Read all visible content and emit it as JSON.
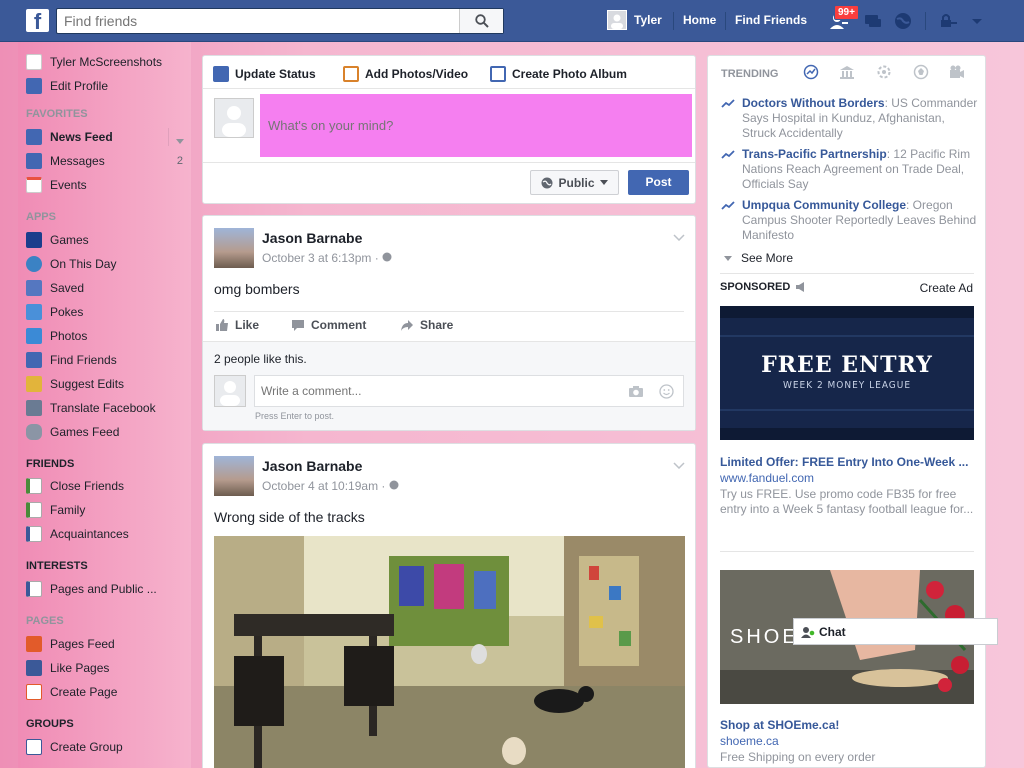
{
  "topbar": {
    "logo": "f",
    "search_placeholder": "Find friends",
    "user_name": "Tyler",
    "home_label": "Home",
    "find_friends_label": "Find Friends",
    "notif_badge": "99+"
  },
  "left_nav": {
    "profile": {
      "name": "Tyler McScreenshots",
      "edit": "Edit Profile"
    },
    "favorites_header": "FAVORITES",
    "favorites": [
      {
        "label": "News Feed",
        "icon": "news-feed-icon",
        "color": "#4267b2"
      },
      {
        "label": "Messages",
        "icon": "messages-icon",
        "color": "#4267b2",
        "count": "2"
      },
      {
        "label": "Events",
        "icon": "events-icon",
        "color": "#e9ebee"
      }
    ],
    "apps_header": "APPS",
    "apps": [
      {
        "label": "Games",
        "icon": "games-icon",
        "color": "#1a3e8c"
      },
      {
        "label": "On This Day",
        "icon": "on-this-day-icon",
        "color": "#3b82c4"
      },
      {
        "label": "Saved",
        "icon": "saved-icon",
        "color": "#5577c0"
      },
      {
        "label": "Pokes",
        "icon": "pokes-icon",
        "color": "#4a90d9"
      },
      {
        "label": "Photos",
        "icon": "photos-icon",
        "color": "#3b8ad6"
      },
      {
        "label": "Find Friends",
        "icon": "find-friends-icon",
        "color": "#4267b2"
      },
      {
        "label": "Suggest Edits",
        "icon": "suggest-edits-icon",
        "color": "#e2b43b"
      },
      {
        "label": "Translate Facebook",
        "icon": "translate-icon",
        "color": "#6a7b93"
      },
      {
        "label": "Games Feed",
        "icon": "games-feed-icon",
        "color": "#8b95a5"
      }
    ],
    "friends_header": "FRIENDS",
    "friends": [
      {
        "label": "Close Friends",
        "icon": "close-friends-icon",
        "color": "#4b8a3a"
      },
      {
        "label": "Family",
        "icon": "family-icon",
        "color": "#4b8a3a"
      },
      {
        "label": "Acquaintances",
        "icon": "acquaintances-icon",
        "color": "#3b5998"
      }
    ],
    "interests_header": "INTERESTS",
    "interests": [
      {
        "label": "Pages and Public ...",
        "icon": "pages-public-icon",
        "color": "#3b5998"
      }
    ],
    "pages_header": "PAGES",
    "pages": [
      {
        "label": "Pages Feed",
        "icon": "pages-feed-icon",
        "color": "#e25b2a"
      },
      {
        "label": "Like Pages",
        "icon": "like-pages-icon",
        "color": "#3b5998"
      },
      {
        "label": "Create Page",
        "icon": "create-page-icon",
        "color": "#e25b2a"
      }
    ],
    "groups_header": "GROUPS",
    "groups": [
      {
        "label": "Create Group",
        "icon": "create-group-icon",
        "color": "#3b5998"
      }
    ]
  },
  "composer": {
    "tab_status": "Update Status",
    "tab_photos": "Add Photos/Video",
    "tab_album": "Create Photo Album",
    "placeholder": "What's on your mind?",
    "privacy": "Public",
    "post": "Post"
  },
  "posts": [
    {
      "author": "Jason Barnabe",
      "time": "October 3 at 6:13pm · ",
      "text": "omg bombers",
      "like": "Like",
      "comment": "Comment",
      "share": "Share",
      "likes_summary": "2 people like this.",
      "comment_placeholder": "Write a comment...",
      "hint": "Press Enter to post."
    },
    {
      "author": "Jason Barnabe",
      "time": "October 4 at 10:19am · ",
      "text": "Wrong side of the tracks"
    }
  ],
  "right": {
    "trending_header": "TRENDING",
    "trending": [
      {
        "title": "Doctors Without Borders",
        "rest": ": US Commander Says Hospital in Kunduz, Afghanistan, Struck Accidentally"
      },
      {
        "title": "Trans-Pacific Partnership",
        "rest": ": 12 Pacific Rim Nations Reach Agreement on Trade Deal, Officials Say"
      },
      {
        "title": "Umpqua Community College",
        "rest": ": Oregon Campus Shooter Reportedly Leaves Behind Manifesto"
      }
    ],
    "see_more": "See More",
    "sponsored": "SPONSORED",
    "create_ad": "Create Ad",
    "ad1": {
      "banner_title": "FREE ENTRY",
      "banner_sub": "WEEK 2 MONEY LEAGUE",
      "title": "Limited Offer: FREE Entry Into One-Week ...",
      "url": "www.fanduel.com",
      "desc": "Try us FREE. Use promo code FB35 for free entry into a Week 5 fantasy football league for..."
    },
    "ad2": {
      "banner_text": "SHOE",
      "title": "Shop at SHOEme.ca!",
      "url": "shoeme.ca",
      "desc": "Free Shipping on every order"
    },
    "chat_label": "Chat"
  }
}
